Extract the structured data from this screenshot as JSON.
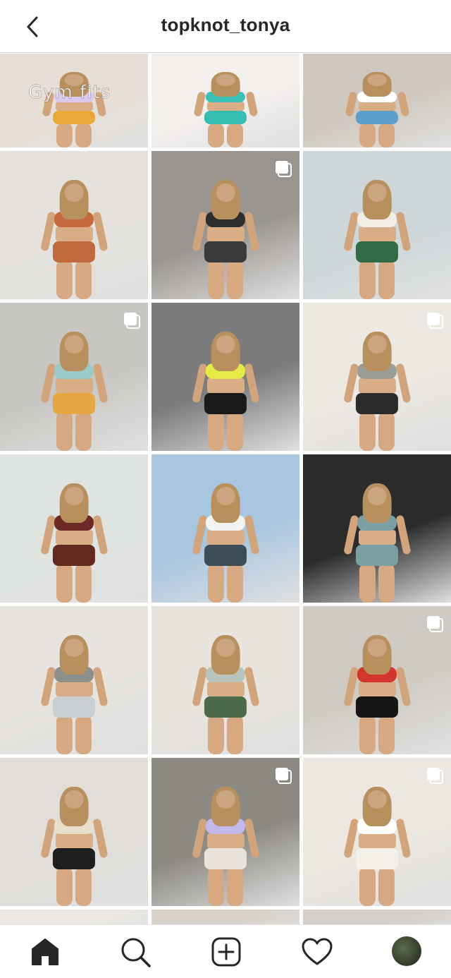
{
  "header": {
    "title": "topknot_tonya",
    "back_icon": "chevron-left-icon"
  },
  "grid": {
    "overlay_text": "Gym fits",
    "tiles": [
      {
        "row": 0,
        "col": 0,
        "bg": "#e7dfd6",
        "top": "#d9c9f0",
        "bottom": "#e8a83a",
        "multi": false
      },
      {
        "row": 0,
        "col": 1,
        "bg": "#f2efed",
        "top": "#3cc1b6",
        "bottom": "#35bdb2",
        "multi": false
      },
      {
        "row": 0,
        "col": 2,
        "bg": "#cfc8bf",
        "top": "#ffffff",
        "bottom": "#5d9fca",
        "multi": false
      },
      {
        "row": 1,
        "col": 0,
        "bg": "#e5e2dd",
        "top": "#c46a3e",
        "bottom": "#c16a3f",
        "multi": false
      },
      {
        "row": 1,
        "col": 1,
        "bg": "#9a9590",
        "top": "#2d2d2d",
        "bottom": "#3a3a3a",
        "multi": true
      },
      {
        "row": 1,
        "col": 2,
        "bg": "#cdd6d8",
        "top": "#f2ede6",
        "bottom": "#2f6c45",
        "multi": false
      },
      {
        "row": 2,
        "col": 0,
        "bg": "#c8c6c2",
        "top": "#9cc9c9",
        "bottom": "#e4a741",
        "multi": true
      },
      {
        "row": 2,
        "col": 1,
        "bg": "#7c7c7c",
        "top": "#e6ec47",
        "bottom": "#1a1a1a",
        "multi": false
      },
      {
        "row": 2,
        "col": 2,
        "bg": "#ece8e2",
        "top": "#9b9d98",
        "bottom": "#2b2b2b",
        "multi": true
      },
      {
        "row": 3,
        "col": 0,
        "bg": "#dfe4e1",
        "top": "#6b2a23",
        "bottom": "#62291f",
        "multi": false
      },
      {
        "row": 3,
        "col": 1,
        "bg": "#a9c6e0",
        "top": "#f3f3f1",
        "bottom": "#3d4d57",
        "multi": false
      },
      {
        "row": 3,
        "col": 2,
        "bg": "#2b2b2b",
        "top": "#7aa0a4",
        "bottom": "#7a9fa5",
        "multi": false
      },
      {
        "row": 4,
        "col": 0,
        "bg": "#e7e4df",
        "top": "#8d8f8d",
        "bottom": "#c9cfd0",
        "multi": false
      },
      {
        "row": 4,
        "col": 1,
        "bg": "#e9e4de",
        "top": "#b9c3bd",
        "bottom": "#4d6a4a",
        "multi": false
      },
      {
        "row": 4,
        "col": 2,
        "bg": "#cfcac3",
        "top": "#d2352c",
        "bottom": "#151515",
        "multi": true
      },
      {
        "row": 5,
        "col": 0,
        "bg": "#e1ded9",
        "top": "#e9ddcc",
        "bottom": "#1e1e1e",
        "multi": false
      },
      {
        "row": 5,
        "col": 1,
        "bg": "#8d8a84",
        "top": "#c3b8ec",
        "bottom": "#e9e2da",
        "multi": true
      },
      {
        "row": 5,
        "col": 2,
        "bg": "#ece8e1",
        "top": "#ffffff",
        "bottom": "#f3f0ea",
        "multi": true
      },
      {
        "row": 6,
        "col": 0,
        "bg": "#ebe8e4",
        "top": "#ffffff",
        "bottom": "#ffffff",
        "multi": false
      },
      {
        "row": 6,
        "col": 1,
        "bg": "#d8d2ca",
        "top": "#ffffff",
        "bottom": "#ffffff",
        "multi": false
      },
      {
        "row": 6,
        "col": 2,
        "bg": "#d3cfca",
        "top": "#ffffff",
        "bottom": "#ffffff",
        "multi": false
      }
    ]
  },
  "nav": {
    "items": [
      {
        "name": "home",
        "icon": "home-icon"
      },
      {
        "name": "search",
        "icon": "search-icon"
      },
      {
        "name": "new-post",
        "icon": "plus-square-icon"
      },
      {
        "name": "activity",
        "icon": "heart-icon"
      },
      {
        "name": "profile",
        "icon": "avatar"
      }
    ]
  },
  "colors": {
    "text": "#262626",
    "divider": "#dbdbdb",
    "background": "#ffffff"
  }
}
